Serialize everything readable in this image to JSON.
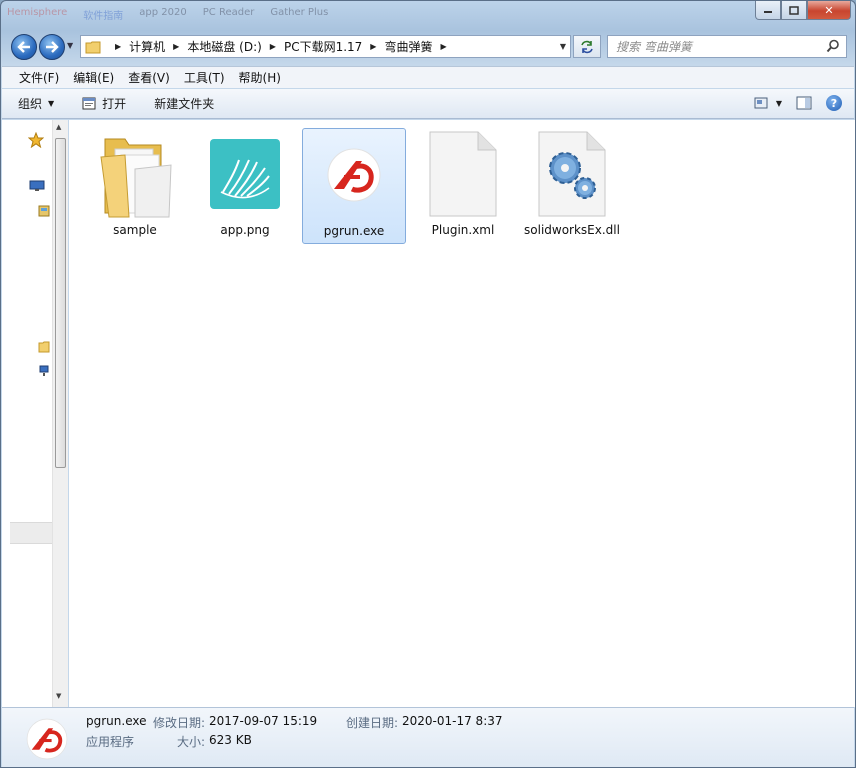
{
  "window": {
    "ghost_title": [
      "Hemisphere",
      "软件指南",
      "app 2020",
      "PC Reader",
      "Gather Plus"
    ],
    "caption": {
      "minimize": "▭",
      "maximize": "□",
      "close": "✕"
    }
  },
  "address_bar": {
    "crumbs": [
      "计算机",
      "本地磁盘 (D:)",
      "PC下载网1.17",
      "弯曲弹簧"
    ]
  },
  "search": {
    "placeholder": "搜索 弯曲弹簧"
  },
  "menu": {
    "items": [
      "文件(F)",
      "编辑(E)",
      "查看(V)",
      "工具(T)",
      "帮助(H)"
    ]
  },
  "toolbar": {
    "organize": "组织",
    "open": "打开",
    "new_folder": "新建文件夹"
  },
  "files": [
    {
      "name": "sample",
      "kind": "folder-icon"
    },
    {
      "name": "app.png",
      "kind": "teal-image-icon"
    },
    {
      "name": "pgrun.exe",
      "kind": "red-logo-icon",
      "selected": true
    },
    {
      "name": "Plugin.xml",
      "kind": "blank-document-icon"
    },
    {
      "name": "solidworksEx.dll",
      "kind": "gears-document-icon"
    }
  ],
  "details": {
    "name": "pgrun.exe",
    "type": "应用程序",
    "modified_label": "修改日期:",
    "modified_value": "2017-09-07 15:19",
    "created_label": "创建日期:",
    "created_value": "2020-01-17 8:37",
    "size_label": "大小:",
    "size_value": "623 KB"
  },
  "colors": {
    "accent_blue": "#2b6bbf",
    "selection_bg": "#cde3fb",
    "logo_red": "#d7261e",
    "app_teal": "#3cc0c4",
    "close_red": "#c8452f"
  }
}
